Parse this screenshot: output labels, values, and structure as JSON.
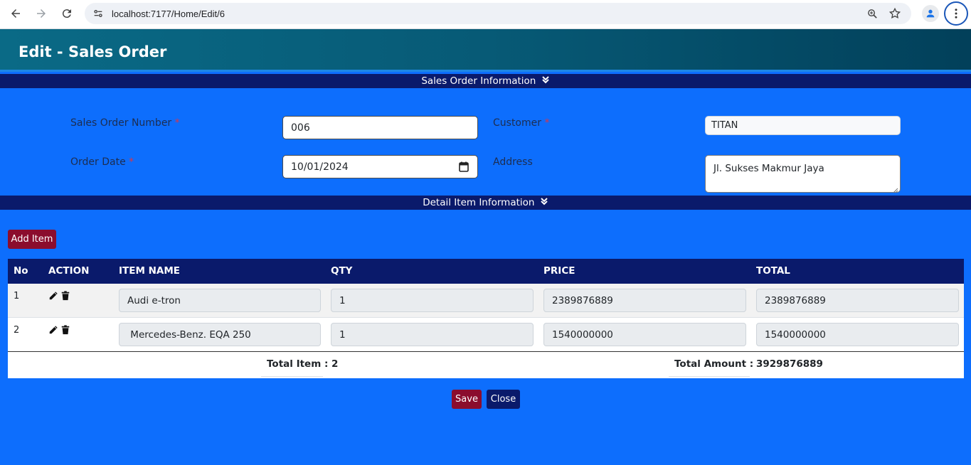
{
  "browser": {
    "url": "localhost:7177/Home/Edit/6",
    "icons": [
      "back-arrow-icon",
      "forward-arrow-icon",
      "reload-icon",
      "site-settings-icon",
      "zoom-icon",
      "bookmark-star-icon",
      "profile-icon",
      "kebab-menu-icon"
    ]
  },
  "header": {
    "title": "Edit - Sales Order"
  },
  "sections": {
    "order_info": "Sales Order Information",
    "detail_info": "Detail Item Information"
  },
  "form": {
    "so_number_label": "Sales Order Number",
    "so_number_value": "006",
    "customer_label": "Customer",
    "customer_value": "TITAN",
    "order_date_label": "Order Date",
    "order_date_value": "10/01/2024",
    "address_label": "Address",
    "address_value": "Jl. Sukses Makmur Jaya",
    "required_mark": "*"
  },
  "buttons": {
    "add_item": "Add Item",
    "save": "Save",
    "close": "Close"
  },
  "table": {
    "headers": {
      "no": "No",
      "action": "ACTION",
      "item_name": "ITEM NAME",
      "qty": "QTY",
      "price": "PRICE",
      "total": "TOTAL"
    },
    "rows": [
      {
        "no": "1",
        "item_name": "Audi e-tron",
        "qty": "1",
        "price": "2389876889",
        "total": "2389876889"
      },
      {
        "no": "2",
        "item_name": " Mercedes-Benz. EQA 250",
        "qty": "1",
        "price": "1540000000",
        "total": "1540000000"
      }
    ],
    "footer": {
      "total_item_label": "Total Item :",
      "total_item_value": "2",
      "total_amount_label": "Total Amount :",
      "total_amount_value": "3929876889"
    }
  },
  "colors": {
    "page_bg": "#0d6efd",
    "navy": "#0a1a6b",
    "red_button": "#8b0d2d",
    "required": "#dc3545"
  }
}
